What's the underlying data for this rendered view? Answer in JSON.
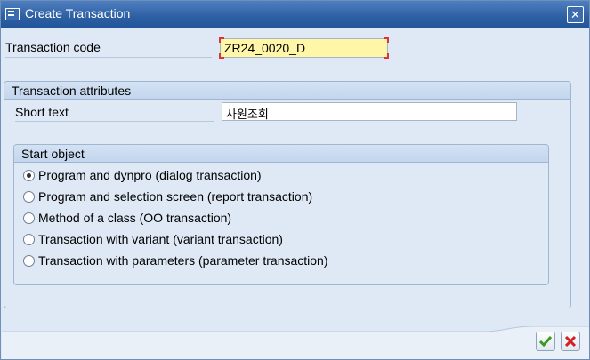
{
  "window": {
    "title": "Create Transaction",
    "icons": {
      "app": "new-transaction-icon",
      "close": "close-icon"
    }
  },
  "transaction_code": {
    "label": "Transaction code",
    "value": "ZR24_0020_D"
  },
  "attributes": {
    "header": "Transaction attributes",
    "short_text_label": "Short text",
    "short_text_value": "사원조회"
  },
  "start_object": {
    "header": "Start object",
    "options": [
      {
        "label": "Program and dynpro (dialog transaction)",
        "checked": true
      },
      {
        "label": "Program and selection screen (report transaction)",
        "checked": false
      },
      {
        "label": "Method of a class (OO transaction)",
        "checked": false
      },
      {
        "label": "Transaction with variant (variant transaction)",
        "checked": false
      },
      {
        "label": "Transaction with parameters (parameter transaction)",
        "checked": false
      }
    ]
  },
  "footer": {
    "confirm_icon": "checkmark-icon",
    "cancel_icon": "cancel-x-icon",
    "confirm_color": "#3a9a1a",
    "cancel_color": "#d21f1f"
  }
}
